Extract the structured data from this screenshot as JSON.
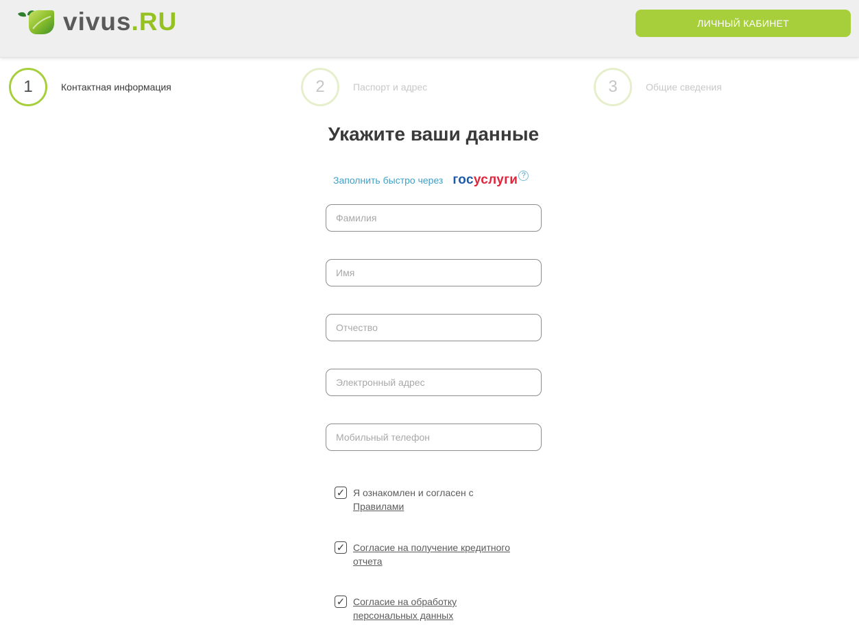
{
  "header": {
    "logo": {
      "brand": "vivus",
      "tld": ".RU"
    },
    "cabinet_button": "ЛИЧНЫЙ КАБИНЕТ"
  },
  "steps": [
    {
      "number": "1",
      "label": "Контактная информация",
      "state": "active"
    },
    {
      "number": "2",
      "label": "Паспорт и адрес",
      "state": "inactive"
    },
    {
      "number": "3",
      "label": "Общие сведения",
      "state": "inactive"
    }
  ],
  "form": {
    "title": "Укажите ваши данные",
    "gosuslugi": {
      "link_text": "Заполнить быстро через",
      "logo_part1": "гос",
      "logo_part2": "услуги",
      "help": "?"
    },
    "fields": [
      {
        "placeholder": "Фамилия",
        "value": ""
      },
      {
        "placeholder": "Имя",
        "value": ""
      },
      {
        "placeholder": "Отчество",
        "value": ""
      },
      {
        "placeholder": "Электронный адрес",
        "value": ""
      },
      {
        "placeholder": "Мобильный телефон",
        "value": ""
      }
    ],
    "checkboxes": [
      {
        "checked": true,
        "text": "Я ознакомлен и согласен с",
        "link": "Правилами"
      },
      {
        "checked": true,
        "text": "",
        "link": "Согласие на получение кредитного отчета"
      },
      {
        "checked": true,
        "text": "",
        "link": "Согласие на обработку персональных данных"
      }
    ],
    "check_mark": "✓"
  },
  "colors": {
    "accent_green": "#a6cf3b",
    "logo_green": "#95c122",
    "link_blue": "#3ea0c9",
    "gos_blue": "#1e5aa8",
    "gos_red": "#e0263d"
  }
}
